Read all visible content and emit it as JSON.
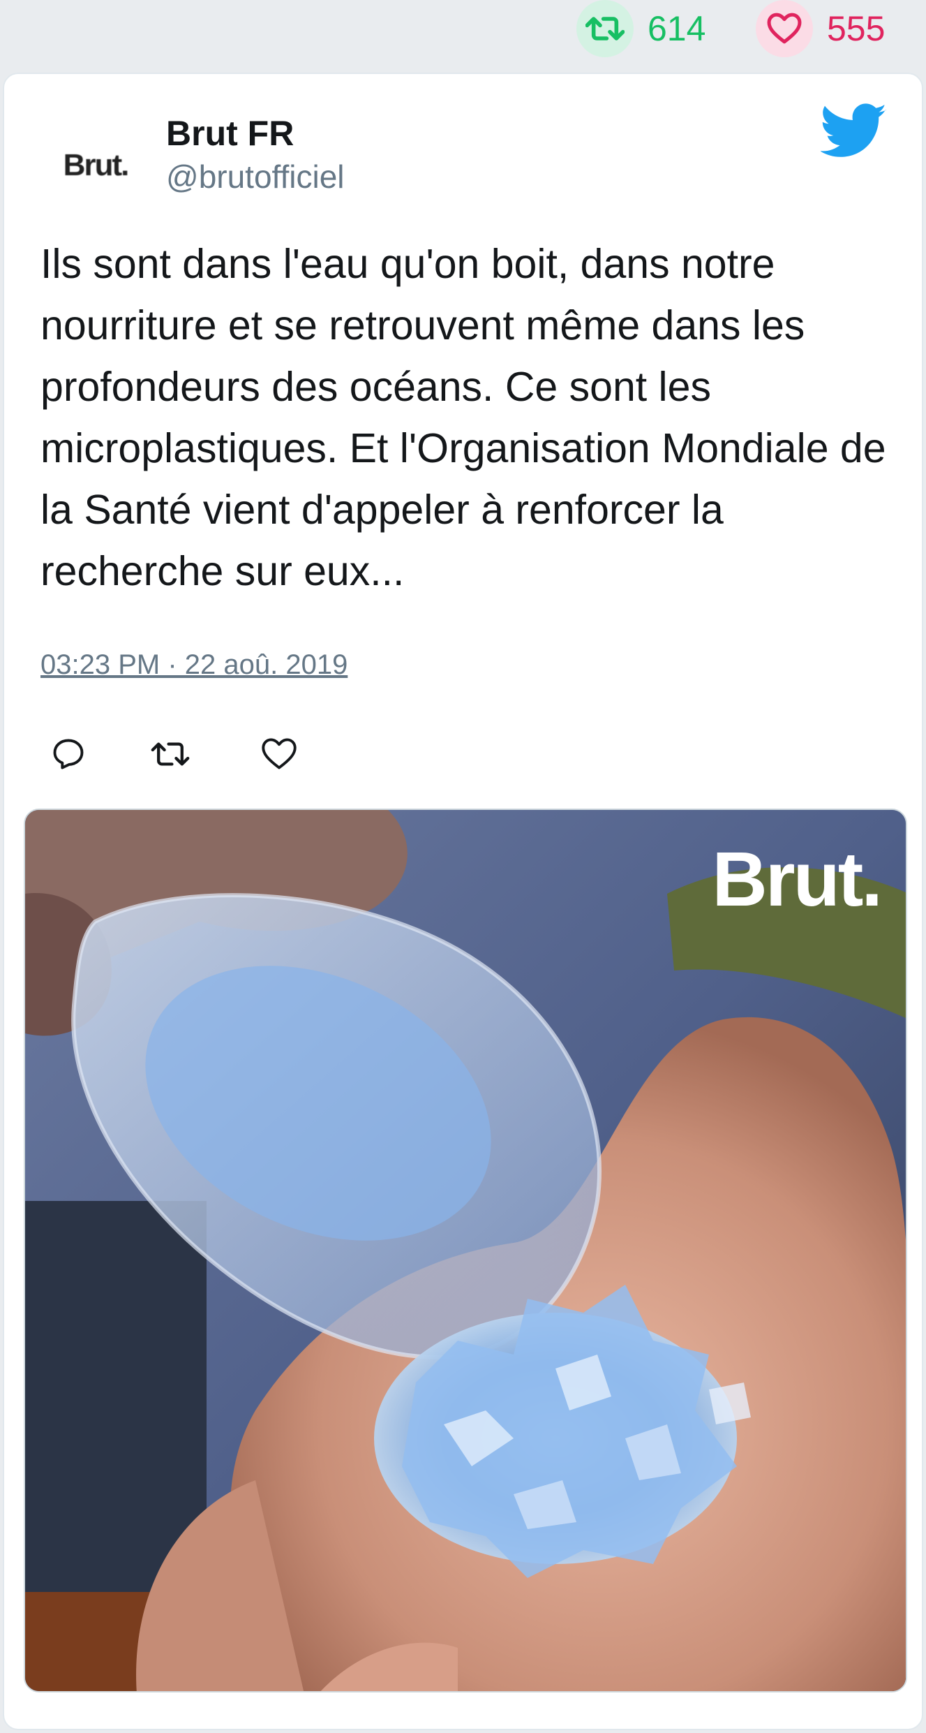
{
  "stats": {
    "retweets": "614",
    "likes": "555",
    "retweet_icon": "retweet-icon",
    "like_icon": "heart-icon"
  },
  "tweet": {
    "avatar_text": "Brut.",
    "author_name": "Brut FR",
    "author_handle": "@brutofficiel",
    "text": "Ils sont dans l'eau qu'on boit, dans notre nourriture et se retrouvent même dans les profondeurs des océans. Ce sont les microplastiques. Et l'Organisation Mondiale de la Santé vient d'appeler à renforcer la recherche sur eux...",
    "timestamp": "03:23 PM · 22 aoû. 2019",
    "media_watermark": "Brut."
  },
  "colors": {
    "retweet_green": "#17bf63",
    "like_pink": "#e0245e",
    "twitter_blue": "#1da1f2",
    "handle_gray": "#657786"
  }
}
